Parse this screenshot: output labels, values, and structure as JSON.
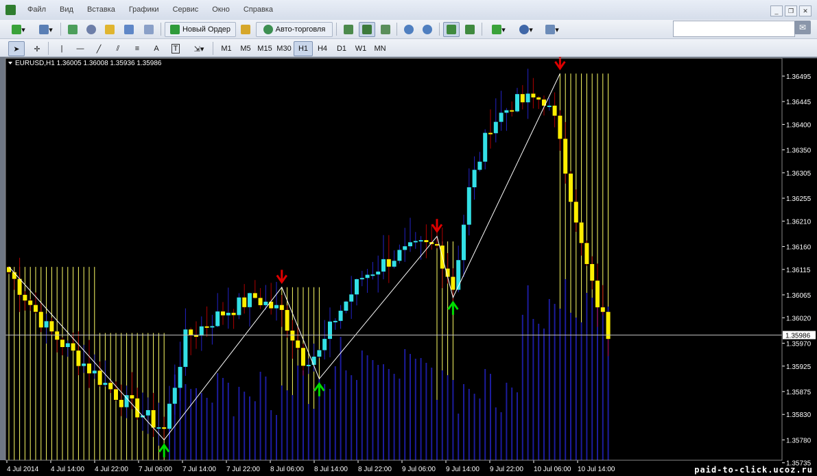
{
  "menu": [
    "Файл",
    "Вид",
    "Вставка",
    "Графики",
    "Сервис",
    "Окно",
    "Справка"
  ],
  "toolbar": {
    "new_order": "Новый Ордер",
    "autotrading": "Авто-торговля",
    "timeframes": [
      "M1",
      "M5",
      "M15",
      "M30",
      "H1",
      "H4",
      "D1",
      "W1",
      "MN"
    ],
    "active_timeframe": "H1",
    "text_tool": "A",
    "label_tool": "T"
  },
  "window_controls": [
    "_",
    "❐",
    "✕"
  ],
  "search": {
    "placeholder": ""
  },
  "chart_title": "EURUSD,H1  1.36005 1.36008 1.35936 1.35986",
  "watermark": "paid-to-click.ucoz.ru",
  "colors": {
    "bg": "#000000",
    "bull": "#33e0e6",
    "bear": "#ffee00",
    "pivot": "#ffff66",
    "volume": "#1c1c9e",
    "buy_arrow": "#00dd00",
    "sell_arrow": "#dd0000",
    "line": "#ffffff"
  },
  "chart_data": {
    "type": "candlestick",
    "symbol": "EURUSD",
    "timeframe": "H1",
    "current_price": 1.35986,
    "ylim": [
      1.3574,
      1.3653
    ],
    "y_ticks": [
      1.36495,
      1.36445,
      1.364,
      1.3635,
      1.36305,
      1.36255,
      1.3621,
      1.3616,
      1.36115,
      1.36065,
      1.3602,
      1.3597,
      1.35925,
      1.35875,
      1.3583,
      1.3578,
      1.35735
    ],
    "x_ticks": [
      "4 Jul 2014",
      "4 Jul 14:00",
      "4 Jul 22:00",
      "7 Jul 06:00",
      "7 Jul 14:00",
      "7 Jul 22:00",
      "8 Jul 06:00",
      "8 Jul 14:00",
      "8 Jul 22:00",
      "9 Jul 06:00",
      "9 Jul 14:00",
      "9 Jul 22:00",
      "10 Jul 06:00",
      "10 Jul 14:00"
    ],
    "zigzag": [
      [
        0,
        1.3612
      ],
      [
        29,
        1.3578
      ],
      [
        51,
        1.3608
      ],
      [
        58,
        1.359
      ],
      [
        80,
        1.3618
      ],
      [
        83,
        1.3606
      ],
      [
        103,
        1.365
      ]
    ],
    "buy_arrows": [
      [
        29,
        1.3577
      ],
      [
        58,
        1.3589
      ],
      [
        83,
        1.3605
      ]
    ],
    "sell_arrows": [
      [
        51,
        1.3609
      ],
      [
        80,
        1.3619
      ],
      [
        103,
        1.3651
      ]
    ],
    "anchors": [
      [
        0,
        1.3611
      ],
      [
        7,
        1.36
      ],
      [
        14,
        1.3593
      ],
      [
        21,
        1.3586
      ],
      [
        29,
        1.358
      ],
      [
        33,
        1.3598
      ],
      [
        40,
        1.3603
      ],
      [
        46,
        1.3606
      ],
      [
        51,
        1.3603
      ],
      [
        55,
        1.3594
      ],
      [
        58,
        1.3595
      ],
      [
        61,
        1.3602
      ],
      [
        66,
        1.361
      ],
      [
        72,
        1.3614
      ],
      [
        77,
        1.3616
      ],
      [
        80,
        1.3616
      ],
      [
        83,
        1.3608
      ],
      [
        86,
        1.3627
      ],
      [
        90,
        1.364
      ],
      [
        94,
        1.3644
      ],
      [
        98,
        1.3645
      ],
      [
        100,
        1.3645
      ],
      [
        103,
        1.3638
      ],
      [
        106,
        1.362
      ],
      [
        109,
        1.3608
      ],
      [
        112,
        1.3599
      ]
    ]
  }
}
